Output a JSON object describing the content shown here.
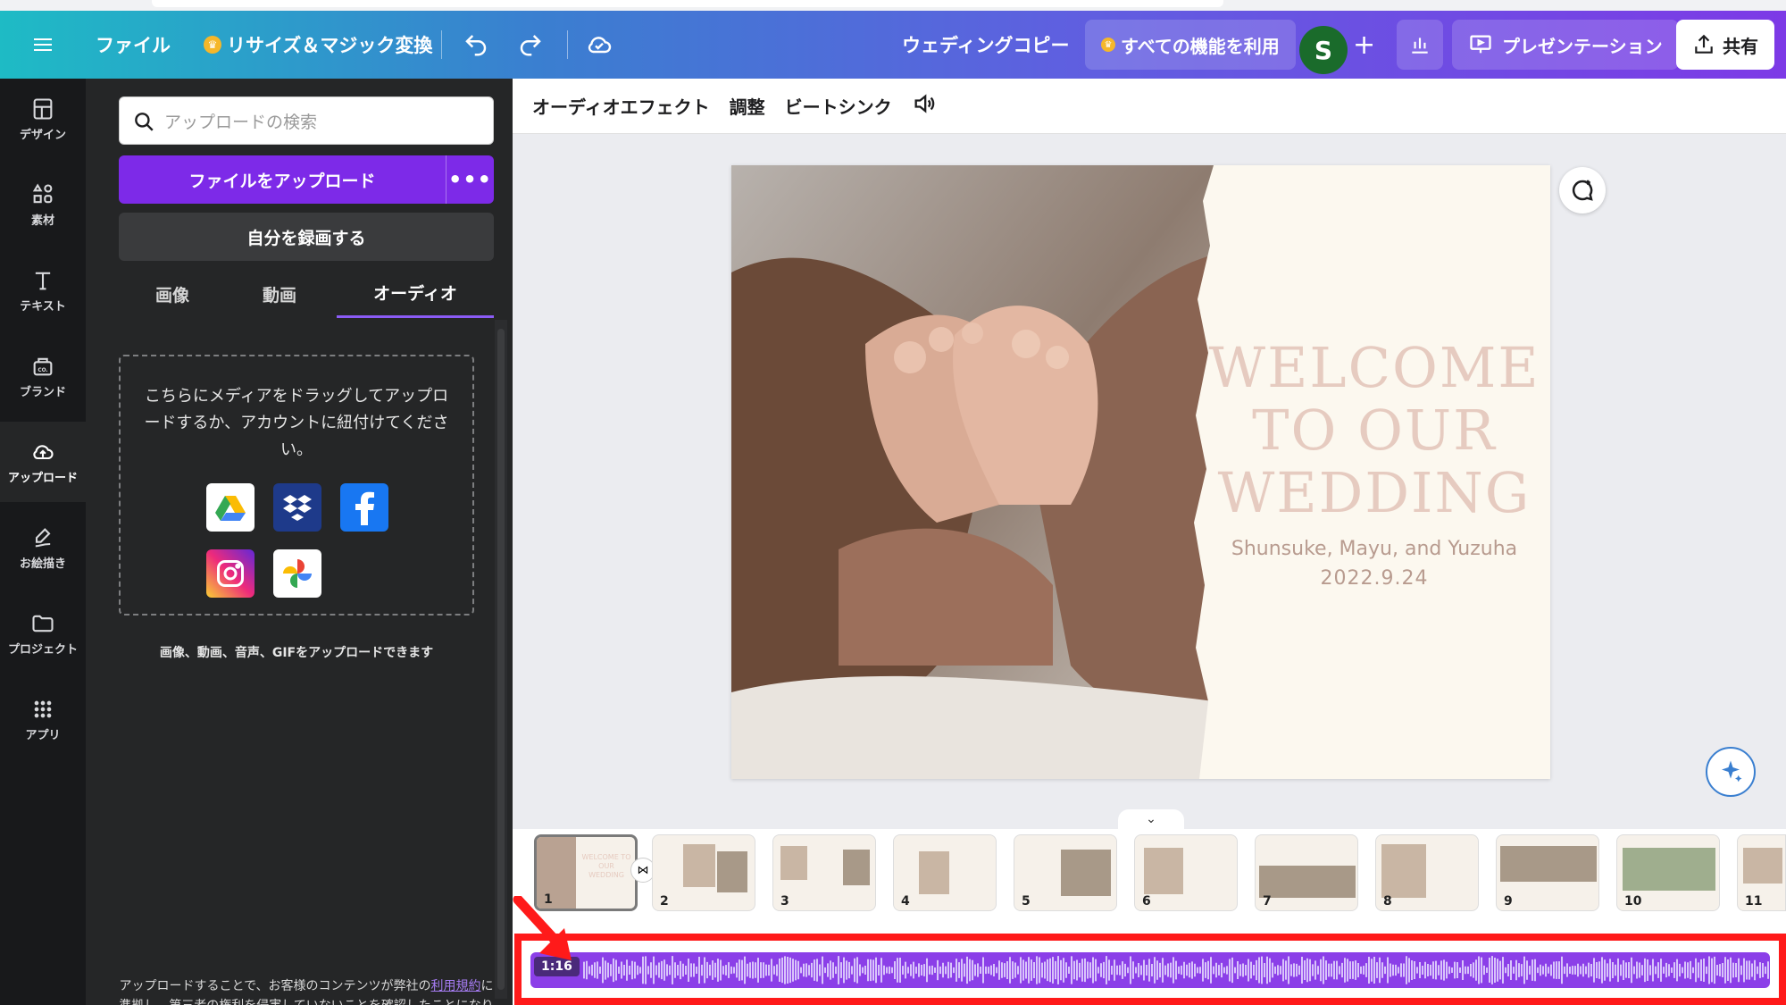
{
  "header": {
    "file_label": "ファイル",
    "resize_label": "リサイズ＆マジック変換",
    "doc_title": "ウェディングコピー",
    "all_features_label": "すべての機能を利用",
    "avatar_initial": "S",
    "present_label": "プレゼンテーション",
    "share_label": "共有",
    "gradient_start": "#1ebbc5",
    "gradient_end": "#7d3ae6"
  },
  "rail": {
    "items": [
      {
        "label": "デザイン",
        "icon": "layout-icon"
      },
      {
        "label": "素材",
        "icon": "shapes-icon"
      },
      {
        "label": "テキスト",
        "icon": "text-icon"
      },
      {
        "label": "ブランド",
        "icon": "brand-icon"
      },
      {
        "label": "アップロード",
        "icon": "cloud-upload-icon"
      },
      {
        "label": "お絵描き",
        "icon": "draw-icon"
      },
      {
        "label": "プロジェクト",
        "icon": "folder-icon"
      },
      {
        "label": "アプリ",
        "icon": "apps-icon"
      }
    ]
  },
  "panel": {
    "search_placeholder": "アップロードの検索",
    "upload_label": "ファイルをアップロード",
    "more_label": "•••",
    "record_label": "自分を録画する",
    "tabs": [
      {
        "label": "画像"
      },
      {
        "label": "動画"
      },
      {
        "label": "オーディオ"
      }
    ],
    "drop_text": "こちらにメディアをドラッグしてアップロードするか、アカウントに紐付けてください。",
    "formats_text": "画像、動画、音声、GIFをアップロードできます",
    "terms_prefix": "アップロードすることで、お客様のコンテンツが弊社の",
    "terms_link": "利用規約",
    "terms_suffix": "に準拠し、第三者の権利を侵害していないことを確認したことになりま"
  },
  "toolbar": {
    "audio_effect": "オーディオエフェクト",
    "adjust": "調整",
    "beat_sync": "ビートシンク"
  },
  "slide": {
    "welcome": "WELCOME TO OUR WEDDING",
    "names": "Shunsuke, Mayu, and Yuzuha",
    "date": "2022.9.24"
  },
  "timeline": {
    "pages": [
      "1",
      "2",
      "3",
      "4",
      "5",
      "6",
      "7",
      "8",
      "9",
      "10",
      "11"
    ],
    "audio_duration": "1:16",
    "accent_color": "#8b3fe8",
    "highlight_color": "#ff1a1a"
  }
}
